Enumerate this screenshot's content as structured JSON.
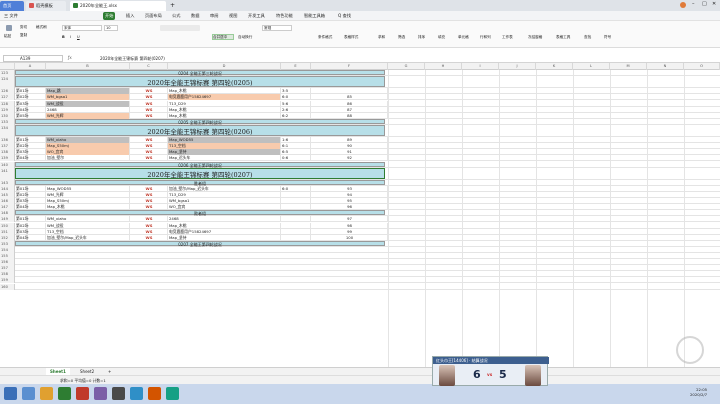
{
  "tabs": {
    "home": "首页",
    "template": "稻壳模板",
    "doc": "2020年全能王.xlsx"
  },
  "menu": [
    "三 文件",
    "开始",
    "插入",
    "页面布局",
    "公式",
    "数据",
    "审阅",
    "视图",
    "开发工具",
    "特色功能",
    "智能工具箱",
    "Q 查找"
  ],
  "ribbon": {
    "paste": "粘贴",
    "cut": "剪切",
    "copy": "复制",
    "painter": "格式刷",
    "font": "宋体",
    "size": "10",
    "merge": "合并居中",
    "wrap": "自动换行",
    "number": "常规",
    "cond": "条件格式",
    "table": "表格样式",
    "sum": "求和",
    "filter": "筛选",
    "sort": "排序",
    "fill": "填充",
    "cellfmt": "单元格",
    "rowcol": "行和列",
    "sheet": "工作表",
    "freeze": "冻结窗格",
    "tools": "表格工具",
    "find": "查找",
    "symbol": "符号"
  },
  "formula": {
    "namebox": "A139",
    "fx": "ƒx",
    "content": "2020年全能王锦标赛 第四轮(0207)"
  },
  "columns": [
    "A",
    "B",
    "C",
    "D",
    "E",
    "F",
    "G",
    "H",
    "I",
    "J",
    "K",
    "L",
    "M",
    "N",
    "O",
    "P"
  ],
  "rows": [
    {
      "n": "123",
      "type": "small",
      "text": "0204 全能王第三轮战况"
    },
    {
      "n": "124",
      "type": "big",
      "text": "2020年全能王锦标赛 第四轮(0205)"
    },
    {
      "n": "126",
      "type": "data",
      "a": "第01场",
      "b": "Map_跳",
      "bc": "gray",
      "c": "WS",
      "d": "Map_木桃",
      "dc": "",
      "e": "3:5",
      "f": ""
    },
    {
      "n": "127",
      "type": "data",
      "a": "第02场",
      "b": "WM_bgsa1",
      "bc": "peach",
      "c": "WS",
      "d": "电竞鹿鹿用户15824697",
      "dc": "peach",
      "e": "6:0",
      "f": "85"
    },
    {
      "n": "128",
      "type": "data",
      "a": "第03场",
      "b": "WM_战役",
      "bc": "gray",
      "c": "WS",
      "d": "T13_D29",
      "dc": "",
      "e": "5:6",
      "f": "86"
    },
    {
      "n": "129",
      "type": "data",
      "a": "第04场",
      "b": "2468",
      "bc": "",
      "c": "WS",
      "d": "Map_木桃",
      "dc": "",
      "e": "2:6",
      "f": "87"
    },
    {
      "n": "130",
      "type": "data",
      "a": "第05场",
      "b": "WM_光辉",
      "bc": "peach",
      "c": "WS",
      "d": "Map_木桃",
      "dc": "",
      "e": "6:2",
      "f": "88"
    },
    {
      "n": "133",
      "type": "small",
      "text": "0205 全能王第四轮战况"
    },
    {
      "n": "134",
      "type": "big",
      "text": "2020年全能王锦标赛 第四轮(0206)"
    },
    {
      "n": "136",
      "type": "data",
      "a": "第01场",
      "b": "WM_xiaho",
      "bc": "gray",
      "c": "WS",
      "d": "Map_WOD55",
      "dc": "gray",
      "e": "1:6",
      "f": "89"
    },
    {
      "n": "137",
      "type": "data",
      "a": "第02场",
      "b": "Map_S50mj",
      "bc": "peach",
      "c": "WS",
      "d": "T13_空档",
      "dc": "peach",
      "e": "6:1",
      "f": "90"
    },
    {
      "n": "138",
      "type": "data",
      "a": "第03场",
      "b": "WO_宜宾",
      "bc": "peach",
      "c": "WS",
      "d": "Map_坚持",
      "dc": "gray",
      "e": "6:5",
      "f": "91"
    },
    {
      "n": "139",
      "type": "data",
      "a": "第04场",
      "b": "加油_壁尔",
      "bc": "",
      "c": "WS",
      "d": "Map_迟头车",
      "dc": "",
      "e": "0:6",
      "f": "92"
    },
    {
      "n": "140",
      "type": "small",
      "text": "0206 全能王第四轮战况"
    },
    {
      "n": "141",
      "type": "bigsel",
      "text": "2020年全能王锦标赛 第四轮(0207)"
    },
    {
      "n": "143",
      "type": "small",
      "text": "胜者组"
    },
    {
      "n": "144",
      "type": "data",
      "a": "第01场",
      "b": "Map_WOD55",
      "bc": "",
      "c": "WS",
      "d": "加油_壁尔/Map_迟头车",
      "dc": "",
      "e": "6:0",
      "f": "93"
    },
    {
      "n": "145",
      "type": "data",
      "a": "第02场",
      "b": "WM_光辉",
      "bc": "",
      "c": "WS",
      "d": "T13_D29",
      "dc": "",
      "e": "",
      "f": "94"
    },
    {
      "n": "146",
      "type": "data",
      "a": "第03场",
      "b": "Map_S50mj",
      "bc": "",
      "c": "WS",
      "d": "WM_bgsa1",
      "dc": "",
      "e": "",
      "f": "95"
    },
    {
      "n": "147",
      "type": "data",
      "a": "第04场",
      "b": "Map_木桃",
      "bc": "",
      "c": "WS",
      "d": "WO_宜宾",
      "dc": "",
      "e": "",
      "f": "96"
    },
    {
      "n": "148",
      "type": "small",
      "text": "败者组"
    },
    {
      "n": "149",
      "type": "data",
      "a": "第01场",
      "b": "WM_xiaho",
      "bc": "",
      "c": "WS",
      "d": "2468",
      "dc": "",
      "e": "",
      "f": "97"
    },
    {
      "n": "150",
      "type": "data",
      "a": "第02场",
      "b": "WM_战役",
      "bc": "",
      "c": "WS",
      "d": "Map_木桃",
      "dc": "",
      "e": "",
      "f": "98"
    },
    {
      "n": "151",
      "type": "data",
      "a": "第03场",
      "b": "T13_空档",
      "bc": "",
      "c": "WS",
      "d": "电竞鹿鹿用户15824697",
      "dc": "",
      "e": "",
      "f": "99"
    },
    {
      "n": "152",
      "type": "data",
      "a": "第04场",
      "b": "加油_壁尔/Map_迟头车",
      "bc": "",
      "c": "WS",
      "d": "Map_坚持",
      "dc": "",
      "e": "",
      "f": "100"
    },
    {
      "n": "153",
      "type": "small",
      "text": "0207 全能王第四轮战况"
    },
    {
      "n": "154",
      "type": "empty"
    },
    {
      "n": "155",
      "type": "empty"
    },
    {
      "n": "156",
      "type": "empty"
    },
    {
      "n": "157",
      "type": "empty"
    },
    {
      "n": "158",
      "type": "empty"
    },
    {
      "n": "159",
      "type": "empty"
    },
    {
      "n": "160",
      "type": "empty"
    }
  ],
  "sheets": [
    "Sheet1",
    "Sheet2"
  ],
  "status": {
    "left": "求和=0  平均值=0  计数=1"
  },
  "popup": {
    "title": "红头巾王[14406] · 结算战况",
    "left_score": "6",
    "vs": "vs",
    "right_score": "5"
  },
  "clock": {
    "time": "22:05",
    "date": "2020/2/7"
  }
}
